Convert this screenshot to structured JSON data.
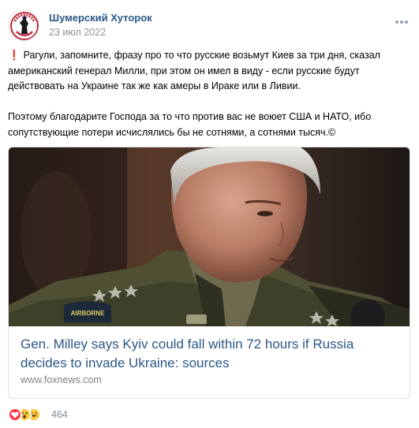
{
  "post": {
    "author": "Шумерский Хуторок",
    "date": "23 июл 2022",
    "paragraph1": "Рагули, запомните, фразу про то что русские возьмут Киев за три дня, сказал американский генерал Милли, при этом он имел в виду - если русские будут действовать на Украине так же как амеры в Ираке или в Ливии.",
    "paragraph2": "Поэтому благодарите Господа за то что против вас не воюет США и НАТО, ибо сопутствующие потери исчислялись бы не сотнями, а сотнями тысяч.©",
    "leading_icon": "red-exclamation-icon"
  },
  "link_card": {
    "title": "Gen. Milley says Kyiv could fall within 72 hours if Russia decides to invade Ukraine: sources",
    "domain": "www.foxnews.com",
    "patch_text": "AIRBORNE"
  },
  "reactions": {
    "icons": [
      "heart-icon",
      "surprised-face-icon",
      "laughing-face-icon"
    ],
    "count": "464"
  },
  "colors": {
    "link_blue": "#2a5885",
    "muted_gray": "#939393",
    "exclamation_red": "#e64646"
  }
}
